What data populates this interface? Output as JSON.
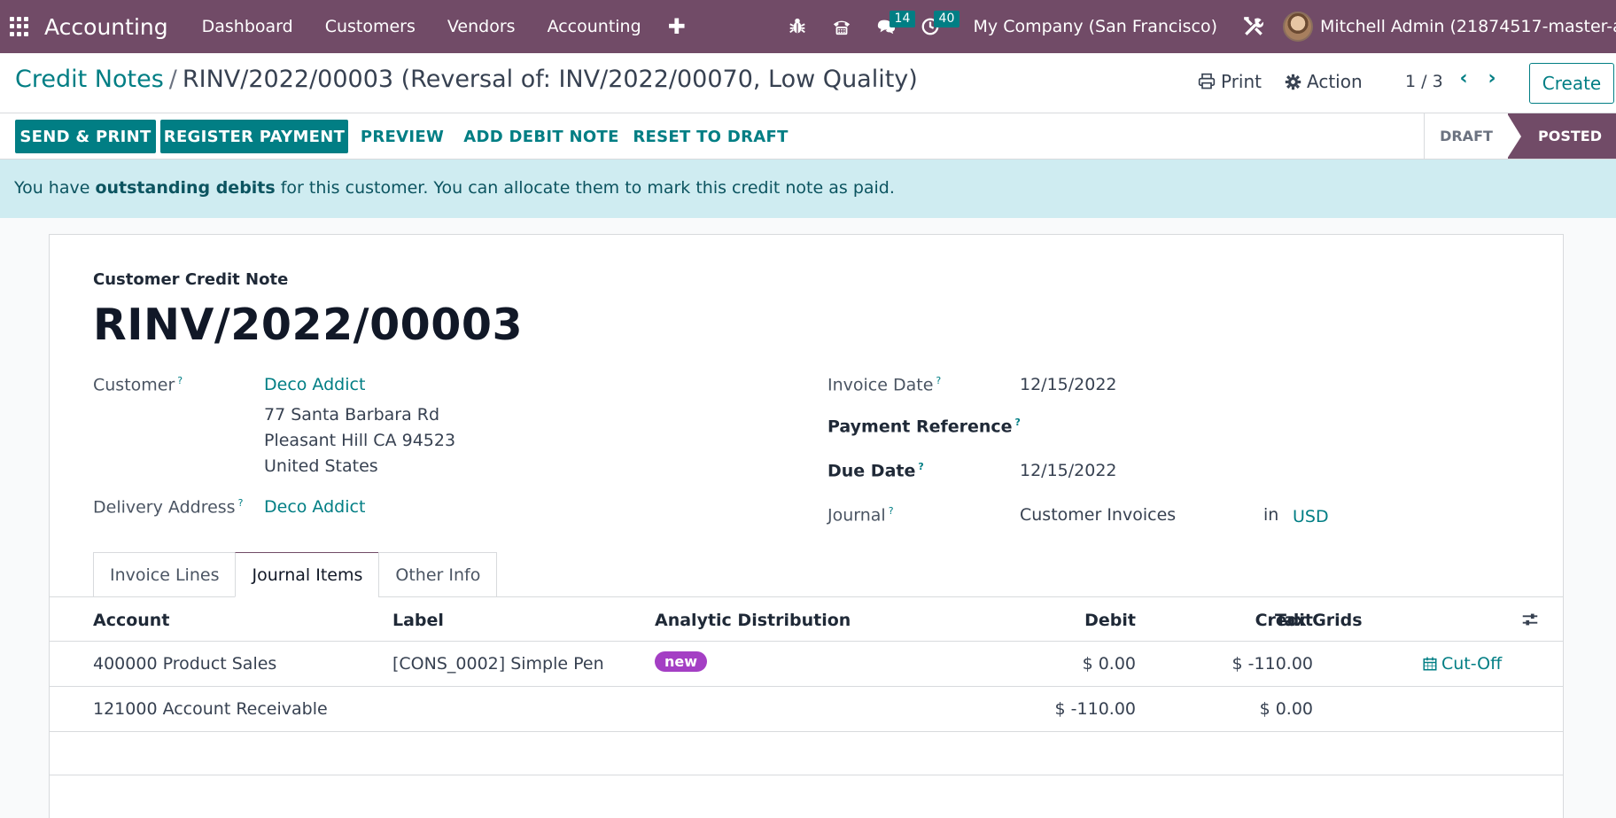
{
  "navbar": {
    "brand": "Accounting",
    "menu": [
      "Dashboard",
      "Customers",
      "Vendors",
      "Accounting"
    ],
    "messages_count": "14",
    "activities_count": "40",
    "company": "My Company (San Francisco)",
    "user": "Mitchell Admin (21874517-master-all)"
  },
  "control": {
    "breadcrumb_parent": "Credit Notes",
    "breadcrumb_separator": "/",
    "breadcrumb_current": "RINV/2022/00003 (Reversal of: INV/2022/00070, Low Quality)",
    "print": "Print",
    "action": "Action",
    "pager": "1 / 3",
    "create": "Create"
  },
  "statusbar": {
    "buttons": [
      "SEND & PRINT",
      "REGISTER PAYMENT",
      "PREVIEW",
      "ADD DEBIT NOTE",
      "RESET TO DRAFT"
    ],
    "stages": [
      "DRAFT",
      "POSTED"
    ],
    "active_stage": "POSTED"
  },
  "alert": {
    "prefix": "You have ",
    "bold": "outstanding debits",
    "suffix": " for this customer. You can allocate them to mark this credit note as paid."
  },
  "form": {
    "subtitle": "Customer Credit Note",
    "title": "RINV/2022/00003",
    "customer_label": "Customer",
    "customer_name": "Deco Addict",
    "address_lines": [
      "77 Santa Barbara Rd",
      "Pleasant Hill CA 94523",
      "United States"
    ],
    "delivery_label": "Delivery Address",
    "delivery_value": "Deco Addict",
    "invoice_date_label": "Invoice Date",
    "invoice_date": "12/15/2022",
    "payment_ref_label": "Payment Reference",
    "due_date_label": "Due Date",
    "due_date": "12/15/2022",
    "journal_label": "Journal",
    "journal": "Customer Invoices",
    "journal_in": "in",
    "currency": "USD",
    "help_mark": "?"
  },
  "tabs": [
    "Invoice Lines",
    "Journal Items",
    "Other Info"
  ],
  "active_tab": "Journal Items",
  "table": {
    "headers": [
      "Account",
      "Label",
      "Analytic Distribution",
      "Debit",
      "Credit",
      "Tax Grids"
    ],
    "rows": [
      {
        "account": "400000 Product Sales",
        "label": "[CONS_0002] Simple Pen",
        "analytic": "new",
        "debit": "$ 0.00",
        "credit": "$ -110.00",
        "action": "Cut-Off"
      },
      {
        "account": "121000 Account Receivable",
        "label": "",
        "analytic": "",
        "debit": "$ -110.00",
        "credit": "$ 0.00",
        "action": ""
      }
    ]
  },
  "colors": {
    "brand": "#714b67",
    "accent": "#017e84",
    "alert_bg": "#cfecf1",
    "badge": "#a43fc4"
  }
}
